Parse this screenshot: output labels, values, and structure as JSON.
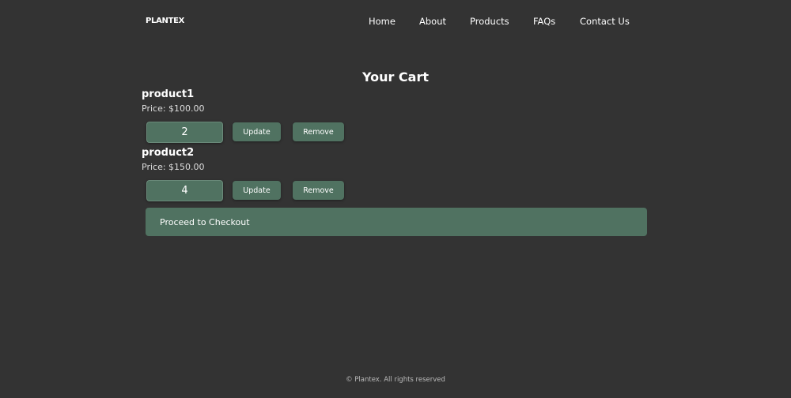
{
  "brand": "PLANTEX",
  "nav": [
    "Home",
    "About",
    "Products",
    "FAQs",
    "Contact Us"
  ],
  "title": "Your Cart",
  "items": [
    {
      "name": "product1",
      "price": "Price: $100.00",
      "quantity": "2"
    },
    {
      "name": "product2",
      "price": "Price: $150.00",
      "quantity": "4"
    }
  ],
  "update_label": "Update",
  "remove_label": "Remove",
  "checkout_label": "Proceed to Checkout",
  "footer": "© Plantex. All rights reserved",
  "colors": {
    "background": "#333333",
    "accent": "#507261"
  }
}
